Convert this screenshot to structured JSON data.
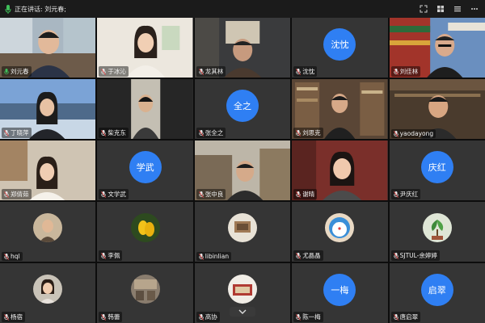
{
  "topbar": {
    "speaking_label": "正在讲话: 刘元春;"
  },
  "participants": [
    {
      "name": "刘元春",
      "kind": "video",
      "mic": "active"
    },
    {
      "name": "于冰沁",
      "kind": "video",
      "mic": "muted"
    },
    {
      "name": "龙其林",
      "kind": "video",
      "mic": "muted"
    },
    {
      "name": "沈忱",
      "kind": "badge",
      "badge": "沈忱",
      "mic": "muted"
    },
    {
      "name": "刘佳林",
      "kind": "video",
      "mic": "muted"
    },
    {
      "name": "丁晓萍",
      "kind": "video",
      "mic": "muted"
    },
    {
      "name": "柴克东",
      "kind": "video",
      "mic": "muted"
    },
    {
      "name": "张全之",
      "kind": "badge",
      "badge": "全之",
      "mic": "muted"
    },
    {
      "name": "刘思克",
      "kind": "video",
      "mic": "muted"
    },
    {
      "name": "yaodayong",
      "kind": "video",
      "mic": "muted"
    },
    {
      "name": "郑倩茹",
      "kind": "video",
      "mic": "muted"
    },
    {
      "name": "文学武",
      "kind": "badge",
      "badge": "学武",
      "mic": "muted"
    },
    {
      "name": "张中良",
      "kind": "video",
      "mic": "muted"
    },
    {
      "name": "谢晴",
      "kind": "video",
      "mic": "muted"
    },
    {
      "name": "尹庆红",
      "kind": "badge",
      "badge": "庆红",
      "mic": "muted"
    },
    {
      "name": "hql",
      "kind": "avatar",
      "mic": "muted"
    },
    {
      "name": "李佩",
      "kind": "avatar",
      "mic": "muted"
    },
    {
      "name": "libinlian",
      "kind": "avatar",
      "mic": "muted"
    },
    {
      "name": "尤晶晶",
      "kind": "avatar",
      "mic": "muted"
    },
    {
      "name": "SJTUL-余婷婷",
      "kind": "avatar",
      "mic": "muted"
    },
    {
      "name": "杨宿",
      "kind": "avatar",
      "mic": "muted"
    },
    {
      "name": "韩蕾",
      "kind": "avatar",
      "mic": "muted"
    },
    {
      "name": "高协",
      "kind": "avatar",
      "mic": "muted"
    },
    {
      "name": "陈一梅",
      "kind": "badge",
      "badge": "一梅",
      "mic": "muted"
    },
    {
      "name": "唐启翠",
      "kind": "badge",
      "badge": "启翠",
      "mic": "muted"
    }
  ],
  "colors": {
    "accent": "#2f7ff3",
    "mic_active": "#3fbf5a",
    "mic_muted": "#e04848"
  },
  "icons": {
    "top_mic": "microphone-icon",
    "window": [
      "fullscreen-icon",
      "grid-view-icon",
      "list-view-icon",
      "more-icon"
    ],
    "page_nav": "chevron-down-icon"
  }
}
